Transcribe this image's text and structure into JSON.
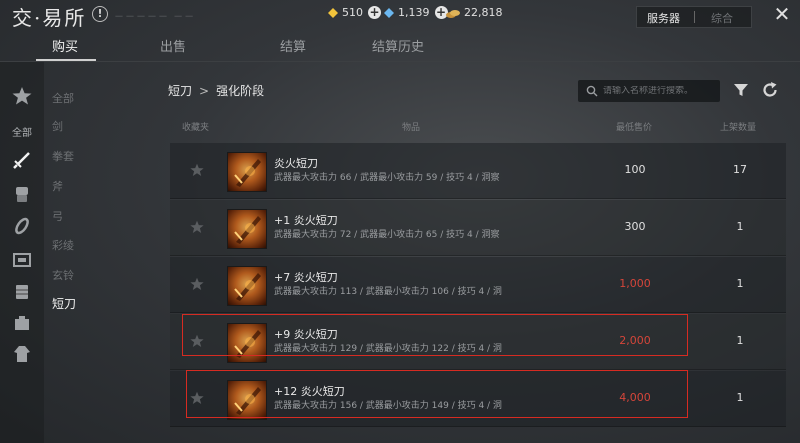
{
  "header": {
    "title": "交·易所",
    "faint_text": "－－－－－ －－",
    "currencies": [
      {
        "name": "gold-gem",
        "value": "510",
        "color": "#f2c43b"
      },
      {
        "name": "blue-gem",
        "value": "1,139",
        "color": "#6bb7f0"
      },
      {
        "name": "coin-pile",
        "value": "22,818",
        "color": "#e0b458"
      }
    ],
    "server_tabs": {
      "active": "服务器",
      "inactive": "综合"
    }
  },
  "tabs": [
    {
      "label": "购买",
      "active": true
    },
    {
      "label": "出售",
      "active": false
    },
    {
      "label": "结算",
      "active": false
    },
    {
      "label": "结算历史",
      "active": false
    }
  ],
  "category_icons": [
    {
      "name": "star-category-icon"
    },
    {
      "name": "dagger-category-icon",
      "selected": true
    },
    {
      "name": "fist-category-icon"
    },
    {
      "name": "spear-category-icon"
    },
    {
      "name": "bow-category-icon"
    },
    {
      "name": "armor-category-icon"
    },
    {
      "name": "accessory-category-icon"
    },
    {
      "name": "robe-category-icon"
    }
  ],
  "category_all_label": "全部",
  "subcategories": [
    {
      "label": "全部"
    },
    {
      "label": "剑"
    },
    {
      "label": "拳套"
    },
    {
      "label": "斧"
    },
    {
      "label": "弓"
    },
    {
      "label": "彩绫"
    },
    {
      "label": "玄铃"
    },
    {
      "label": "短刀",
      "active": true
    }
  ],
  "breadcrumb": {
    "parent": "短刀",
    "separator": ">",
    "current": "强化阶段"
  },
  "search": {
    "placeholder": "请输入名称进行搜索。"
  },
  "table": {
    "headers": {
      "favorite": "收藏夹",
      "item": "物品",
      "price": "最低售价",
      "quantity": "上架数量"
    },
    "rows": [
      {
        "name": "炎火短刀",
        "stats": "武器最大攻击力 66 / 武器最小攻击力 59 / 技巧 4 / 洞察",
        "price": "100",
        "qty": "17",
        "price_red": false
      },
      {
        "name": "+1 炎火短刀",
        "stats": "武器最大攻击力 72 / 武器最小攻击力 65 / 技巧 4 / 洞察",
        "price": "300",
        "qty": "1",
        "price_red": false
      },
      {
        "name": "+7 炎火短刀",
        "stats": "武器最大攻击力 113 / 武器最小攻击力 106 / 技巧 4 / 洞",
        "price": "1,000",
        "qty": "1",
        "price_red": true
      },
      {
        "name": "+9 炎火短刀",
        "stats": "武器最大攻击力 129 / 武器最小攻击力 122 / 技巧 4 / 洞",
        "price": "2,000",
        "qty": "1",
        "price_red": true
      },
      {
        "name": "+12 炎火短刀",
        "stats": "武器最大攻击力 156 / 武器最小攻击力 149 / 技巧 4 / 洞",
        "price": "4,000",
        "qty": "1",
        "price_red": true
      }
    ]
  },
  "colors": {
    "price_red": "#d4453a",
    "highlight_red": "#d62b22"
  }
}
